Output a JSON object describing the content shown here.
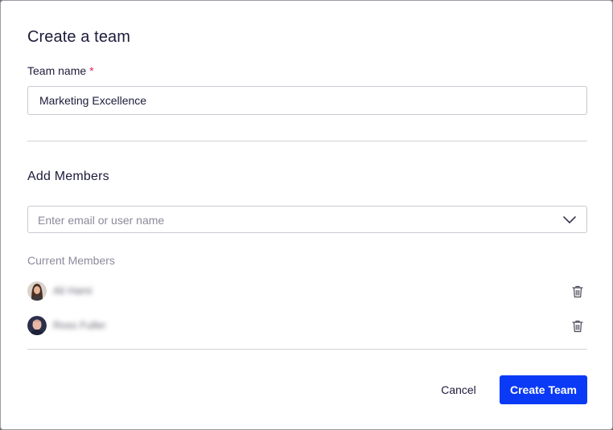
{
  "dialog": {
    "title": "Create a team"
  },
  "team_name": {
    "label": "Team name",
    "required_mark": "*",
    "value": "Marketing Excellence"
  },
  "add_members": {
    "title": "Add Members",
    "search_placeholder": "Enter email or user name"
  },
  "current_members": {
    "label": "Current Members",
    "members": [
      {
        "name": "Ali Hami"
      },
      {
        "name": "Ross Fuller"
      }
    ]
  },
  "actions": {
    "cancel_label": "Cancel",
    "create_label": "Create Team"
  },
  "colors": {
    "primary": "#0a3af5",
    "required": "#e0245e",
    "text": "#1c1b3a",
    "muted": "#8b8a9c"
  }
}
